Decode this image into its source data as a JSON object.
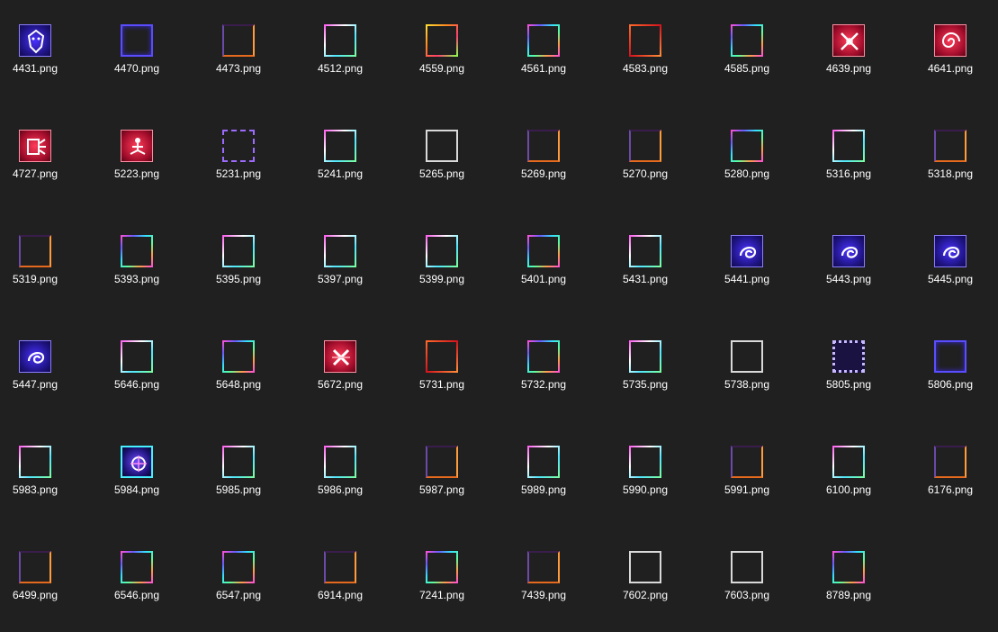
{
  "files": [
    {
      "name": "4431.png",
      "style": "icon-blue",
      "icon": "eagle-icon"
    },
    {
      "name": "4470.png",
      "style": "b-blue"
    },
    {
      "name": "4473.png",
      "style": "b-split"
    },
    {
      "name": "4512.png",
      "style": "b-pinkcyan"
    },
    {
      "name": "4559.png",
      "style": "b-gold"
    },
    {
      "name": "4561.png",
      "style": "b-rainbow"
    },
    {
      "name": "4583.png",
      "style": "b-red"
    },
    {
      "name": "4585.png",
      "style": "b-rainbow"
    },
    {
      "name": "4639.png",
      "style": "icon-red",
      "icon": "crossed-swords-icon"
    },
    {
      "name": "4641.png",
      "style": "icon-red",
      "icon": "spiral-shell-icon"
    },
    {
      "name": "4727.png",
      "style": "icon-red",
      "icon": "burst-cube-icon"
    },
    {
      "name": "5223.png",
      "style": "icon-red",
      "icon": "meditating-figure-icon"
    },
    {
      "name": "5231.png",
      "style": "b-corner"
    },
    {
      "name": "5241.png",
      "style": "b-pinkcyan"
    },
    {
      "name": "5265.png",
      "style": "b-white"
    },
    {
      "name": "5269.png",
      "style": "b-split"
    },
    {
      "name": "5270.png",
      "style": "b-split"
    },
    {
      "name": "5280.png",
      "style": "b-rainbow"
    },
    {
      "name": "5316.png",
      "style": "b-pinkcyan"
    },
    {
      "name": "5318.png",
      "style": "b-split"
    },
    {
      "name": "5319.png",
      "style": "b-split"
    },
    {
      "name": "5393.png",
      "style": "b-rainbow"
    },
    {
      "name": "5395.png",
      "style": "b-pinkcyan"
    },
    {
      "name": "5397.png",
      "style": "b-pinkcyan"
    },
    {
      "name": "5399.png",
      "style": "b-pinkcyan"
    },
    {
      "name": "5401.png",
      "style": "b-rainbow"
    },
    {
      "name": "5431.png",
      "style": "b-pinkcyan"
    },
    {
      "name": "5441.png",
      "style": "icon-blue",
      "icon": "swirl-rune-icon"
    },
    {
      "name": "5443.png",
      "style": "icon-blue",
      "icon": "swirl-rune-icon"
    },
    {
      "name": "5445.png",
      "style": "icon-blue",
      "icon": "swirl-rune-icon"
    },
    {
      "name": "5447.png",
      "style": "icon-blue",
      "icon": "swirl-rune-icon"
    },
    {
      "name": "5646.png",
      "style": "b-pinkcyan"
    },
    {
      "name": "5648.png",
      "style": "b-rainbow"
    },
    {
      "name": "5672.png",
      "style": "icon-red",
      "icon": "crossed-blades-icon"
    },
    {
      "name": "5731.png",
      "style": "b-red"
    },
    {
      "name": "5732.png",
      "style": "b-rainbow"
    },
    {
      "name": "5735.png",
      "style": "b-pinkcyan"
    },
    {
      "name": "5738.png",
      "style": "b-white"
    },
    {
      "name": "5805.png",
      "style": "b-dotted"
    },
    {
      "name": "5806.png",
      "style": "b-blue"
    },
    {
      "name": "5983.png",
      "style": "b-pinkcyan"
    },
    {
      "name": "5984.png",
      "style": "icon-rainbow",
      "icon": "lotus-icon"
    },
    {
      "name": "5985.png",
      "style": "b-pinkcyan"
    },
    {
      "name": "5986.png",
      "style": "b-pinkcyan"
    },
    {
      "name": "5987.png",
      "style": "b-split"
    },
    {
      "name": "5989.png",
      "style": "b-pinkcyan"
    },
    {
      "name": "5990.png",
      "style": "b-pinkcyan"
    },
    {
      "name": "5991.png",
      "style": "b-split"
    },
    {
      "name": "6100.png",
      "style": "b-pinkcyan"
    },
    {
      "name": "6176.png",
      "style": "b-split"
    },
    {
      "name": "6499.png",
      "style": "b-split"
    },
    {
      "name": "6546.png",
      "style": "b-rainbow"
    },
    {
      "name": "6547.png",
      "style": "b-rainbow"
    },
    {
      "name": "6914.png",
      "style": "b-split"
    },
    {
      "name": "7241.png",
      "style": "b-rainbow"
    },
    {
      "name": "7439.png",
      "style": "b-split"
    },
    {
      "name": "7602.png",
      "style": "b-white"
    },
    {
      "name": "7603.png",
      "style": "b-white"
    },
    {
      "name": "8789.png",
      "style": "b-rainbow"
    }
  ],
  "colors": {
    "background": "#202020",
    "label": "#ffffff"
  }
}
